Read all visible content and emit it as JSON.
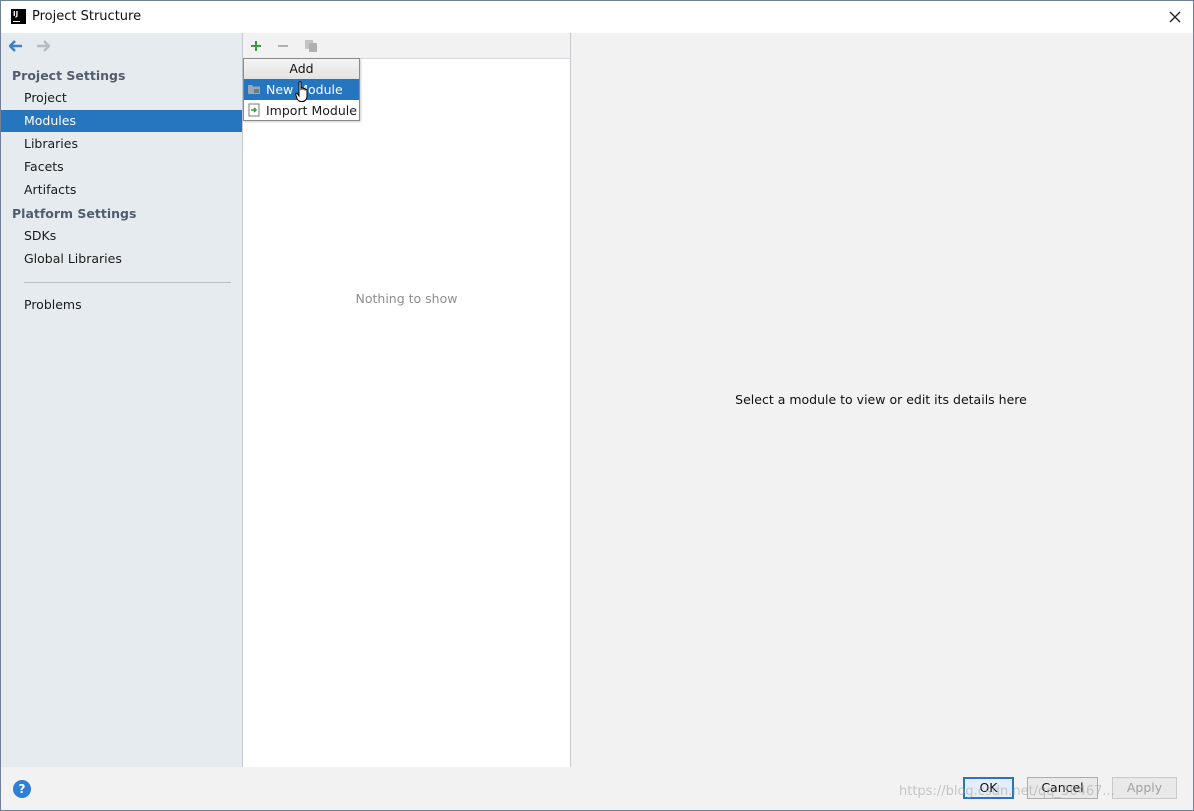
{
  "window": {
    "title": "Project Structure"
  },
  "sidebar": {
    "project_settings_header": "Project Settings",
    "platform_settings_header": "Platform Settings",
    "items": [
      {
        "label": "Project"
      },
      {
        "label": "Modules"
      },
      {
        "label": "Libraries"
      },
      {
        "label": "Facets"
      },
      {
        "label": "Artifacts"
      },
      {
        "label": "SDKs"
      },
      {
        "label": "Global Libraries"
      },
      {
        "label": "Problems"
      }
    ],
    "selected": "Modules",
    "help_label": "?"
  },
  "middle": {
    "empty_text": "Nothing to show"
  },
  "add_popup": {
    "title": "Add",
    "items": [
      {
        "label": "New Module",
        "icon": "module-folder-icon"
      },
      {
        "label": "Import Module",
        "icon": "import-module-icon"
      }
    ],
    "selected": "New Module"
  },
  "details": {
    "placeholder": "Select a module to view or edit its details here"
  },
  "buttons": {
    "ok": "OK",
    "cancel": "Cancel",
    "apply": "Apply"
  },
  "watermark": "https://blog.csdn.net/qq_36467...",
  "colors": {
    "selection": "#2675bf",
    "sidebar_bg": "#e6ebf0",
    "add_icon": "#3b9a3b"
  }
}
